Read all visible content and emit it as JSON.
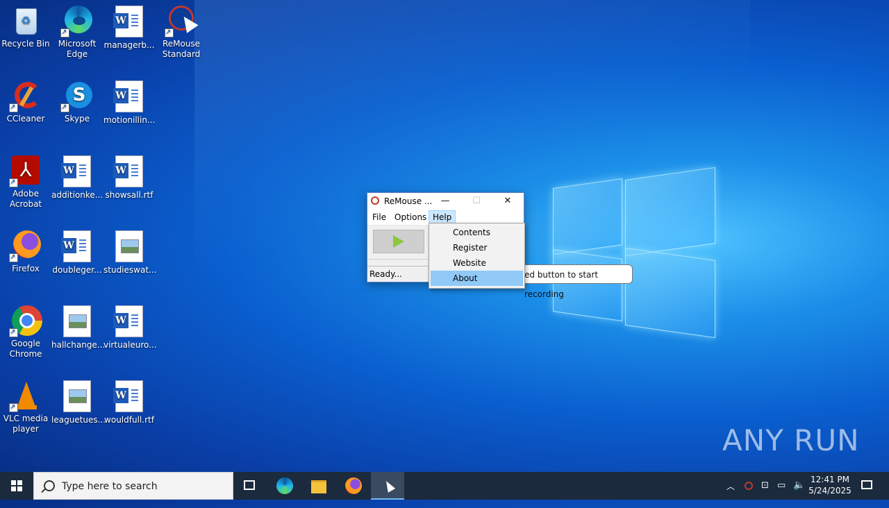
{
  "desktop": {
    "icons": [
      {
        "label": "Recycle Bin"
      },
      {
        "label": "Microsoft Edge"
      },
      {
        "label": "managerb..."
      },
      {
        "label": "ReMouse Standard"
      },
      {
        "label": "CCleaner"
      },
      {
        "label": "Skype"
      },
      {
        "label": "motionillin..."
      },
      {
        "label": "Adobe Acrobat"
      },
      {
        "label": "additionke..."
      },
      {
        "label": "showsall.rtf"
      },
      {
        "label": "Firefox"
      },
      {
        "label": "doubleger..."
      },
      {
        "label": "studieswat..."
      },
      {
        "label": "Google Chrome"
      },
      {
        "label": "hallchange..."
      },
      {
        "label": "virtualeuro..."
      },
      {
        "label": "VLC media player"
      },
      {
        "label": "leaguetues..."
      },
      {
        "label": "wouldfull.rtf"
      }
    ]
  },
  "remouse": {
    "title": "ReMouse ...",
    "menu": {
      "file": "File",
      "options": "Options",
      "help": "Help"
    },
    "status": "Ready...",
    "help_menu": [
      "Contents",
      "Register",
      "Website",
      "About"
    ],
    "tooltip": "ed button to start recording"
  },
  "watermark": "ANY RUN",
  "taskbar": {
    "search_placeholder": "Type here to search",
    "time": "12:41 PM",
    "date": "5/24/2025"
  }
}
